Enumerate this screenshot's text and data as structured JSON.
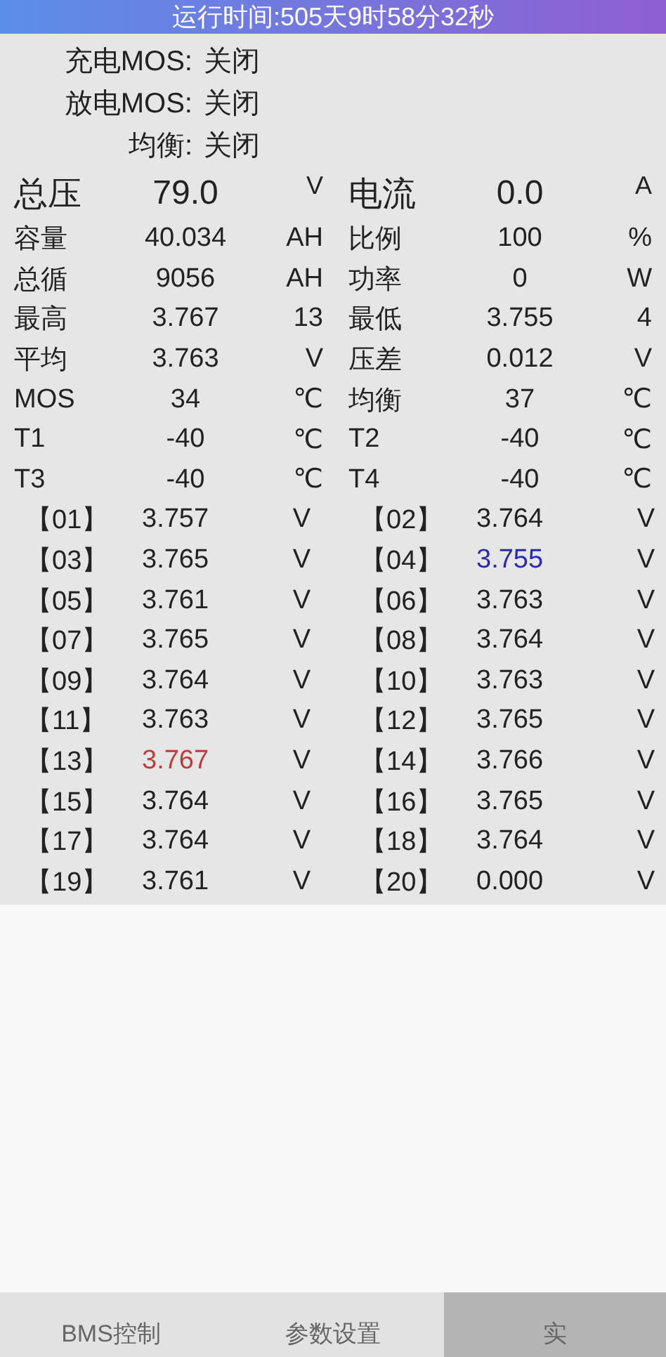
{
  "header": {
    "text": "运行时间:505天9时58分32秒"
  },
  "mos_status": [
    {
      "label": "充电MOS:",
      "value": "关闭"
    },
    {
      "label": "放电MOS:",
      "value": "关闭"
    },
    {
      "label": "均衡:",
      "value": "关闭"
    }
  ],
  "summary_rows": [
    {
      "kind": "large",
      "cells": [
        {
          "label": "总压",
          "value": "79.0",
          "unit": "V"
        },
        {
          "label": "电流",
          "value": "0.0",
          "unit": "A"
        }
      ]
    },
    {
      "kind": "normal",
      "cells": [
        {
          "label": "容量",
          "value": "40.034",
          "unit": "AH"
        },
        {
          "label": "比例",
          "value": "100",
          "unit": "%"
        }
      ]
    },
    {
      "kind": "normal",
      "cells": [
        {
          "label": "总循",
          "value": "9056",
          "unit": "AH"
        },
        {
          "label": "功率",
          "value": "0",
          "unit": "W"
        }
      ]
    },
    {
      "kind": "normal",
      "cells": [
        {
          "label": "最高",
          "value": "3.767",
          "unit": "13"
        },
        {
          "label": "最低",
          "value": "3.755",
          "unit": "4"
        }
      ]
    },
    {
      "kind": "normal",
      "cells": [
        {
          "label": "平均",
          "value": "3.763",
          "unit": "V"
        },
        {
          "label": "压差",
          "value": "0.012",
          "unit": "V"
        }
      ]
    },
    {
      "kind": "normal",
      "cells": [
        {
          "label": "MOS",
          "value": "34",
          "unit": "℃"
        },
        {
          "label": "均衡",
          "value": "37",
          "unit": "℃"
        }
      ]
    },
    {
      "kind": "normal",
      "cells": [
        {
          "label": "T1",
          "value": "-40",
          "unit": "℃"
        },
        {
          "label": "T2",
          "value": "-40",
          "unit": "℃"
        }
      ]
    },
    {
      "kind": "normal",
      "cells": [
        {
          "label": "T3",
          "value": "-40",
          "unit": "℃"
        },
        {
          "label": "T4",
          "value": "-40",
          "unit": "℃"
        }
      ]
    }
  ],
  "cells": [
    {
      "label": "【01】",
      "value": "3.757",
      "unit": "V",
      "color": "#222222"
    },
    {
      "label": "【02】",
      "value": "3.764",
      "unit": "V",
      "color": "#222222"
    },
    {
      "label": "【03】",
      "value": "3.765",
      "unit": "V",
      "color": "#222222"
    },
    {
      "label": "【04】",
      "value": "3.755",
      "unit": "V",
      "color": "#2a2aa8"
    },
    {
      "label": "【05】",
      "value": "3.761",
      "unit": "V",
      "color": "#222222"
    },
    {
      "label": "【06】",
      "value": "3.763",
      "unit": "V",
      "color": "#222222"
    },
    {
      "label": "【07】",
      "value": "3.765",
      "unit": "V",
      "color": "#222222"
    },
    {
      "label": "【08】",
      "value": "3.764",
      "unit": "V",
      "color": "#222222"
    },
    {
      "label": "【09】",
      "value": "3.764",
      "unit": "V",
      "color": "#222222"
    },
    {
      "label": "【10】",
      "value": "3.763",
      "unit": "V",
      "color": "#222222"
    },
    {
      "label": "【11】",
      "value": "3.763",
      "unit": "V",
      "color": "#222222"
    },
    {
      "label": "【12】",
      "value": "3.765",
      "unit": "V",
      "color": "#222222"
    },
    {
      "label": "【13】",
      "value": "3.767",
      "unit": "V",
      "color": "#c03a3a"
    },
    {
      "label": "【14】",
      "value": "3.766",
      "unit": "V",
      "color": "#222222"
    },
    {
      "label": "【15】",
      "value": "3.764",
      "unit": "V",
      "color": "#222222"
    },
    {
      "label": "【16】",
      "value": "3.765",
      "unit": "V",
      "color": "#222222"
    },
    {
      "label": "【17】",
      "value": "3.764",
      "unit": "V",
      "color": "#222222"
    },
    {
      "label": "【18】",
      "value": "3.764",
      "unit": "V",
      "color": "#222222"
    },
    {
      "label": "【19】",
      "value": "3.761",
      "unit": "V",
      "color": "#222222"
    },
    {
      "label": "【20】",
      "value": "0.000",
      "unit": "V",
      "color": "#222222"
    }
  ],
  "tabs": [
    {
      "label": "BMS控制",
      "selected": false
    },
    {
      "label": "参数设置",
      "selected": false
    },
    {
      "label": "实",
      "selected": true
    }
  ]
}
